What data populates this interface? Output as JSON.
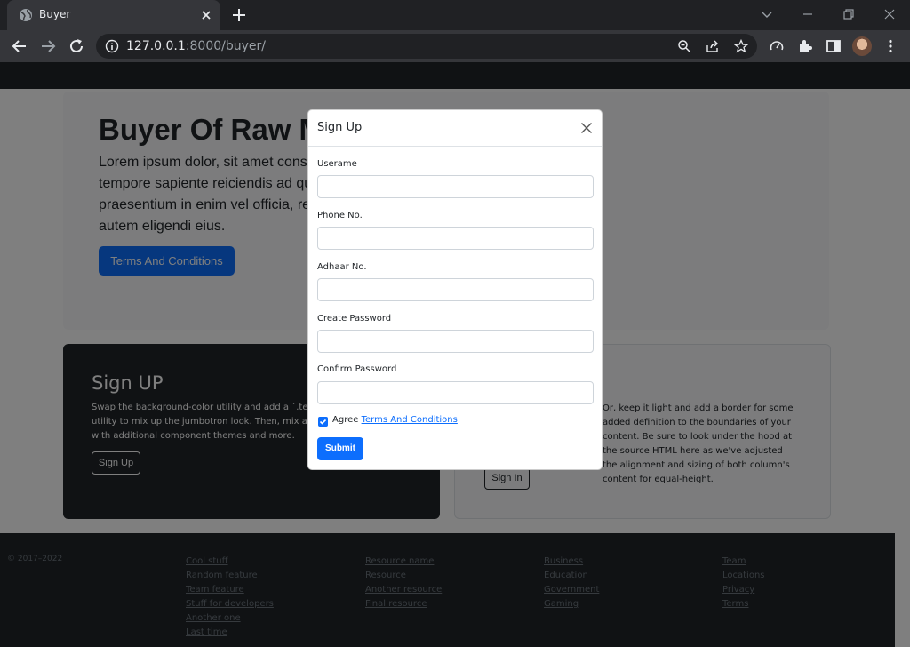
{
  "browser": {
    "tab_title": "Buyer",
    "url_host": "127.0.0.1",
    "url_rest": ":8000/buyer/"
  },
  "hero": {
    "title": "Buyer Of Raw Materials",
    "text": "Lorem ipsum dolor, sit amet consectetur adipisicing elit. Quibusdam quod tempore sapiente reiciendis ad quibusdam esse voluptates, blanditiis praesentium in enim vel officia, reiciendis temporibus ut est omnis. Quod autem eligendi eius.",
    "button": "Terms And Conditions"
  },
  "signup_card": {
    "title": "Sign UP",
    "text": "Swap the background-color utility and add a `.text-*` color utility to mix up the jumbotron look. Then, mix and match with additional component themes and more.",
    "button": "Sign Up"
  },
  "signin_card": {
    "text": "Or, keep it light and add a border for some added definition to the boundaries of your content. Be sure to look under the hood at the source HTML here as we've adjusted the alignment and sizing of both column's content for equal-height.",
    "button": "Sign In"
  },
  "footer": {
    "copyright": "© 2017–2022",
    "col1": [
      "Cool stuff",
      "Random feature",
      "Team feature",
      "Stuff for developers",
      "Another one",
      "Last time"
    ],
    "col2": [
      "Resource name",
      "Resource",
      "Another resource",
      "Final resource"
    ],
    "col3": [
      "Business",
      "Education",
      "Government",
      "Gaming"
    ],
    "col4": [
      "Team",
      "Locations",
      "Privacy",
      "Terms"
    ]
  },
  "modal": {
    "title": "Sign Up",
    "fields": [
      {
        "label": "Userame",
        "value": ""
      },
      {
        "label": "Phone No.",
        "value": ""
      },
      {
        "label": "Adhaar No.",
        "value": ""
      },
      {
        "label": "Create Password",
        "value": ""
      },
      {
        "label": "Confirm Password",
        "value": ""
      }
    ],
    "agree_text": "Agree",
    "agree_link": "Terms And Conditions",
    "agree_checked": true,
    "submit": "Submit"
  },
  "colors": {
    "primary": "#0d6efd",
    "dark": "#212529"
  }
}
